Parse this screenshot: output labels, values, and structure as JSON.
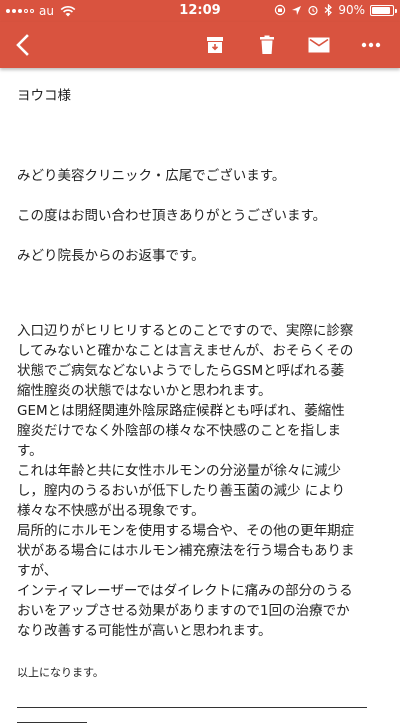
{
  "status_bar": {
    "carrier": "au",
    "time": "12:09",
    "battery_text": "90%",
    "battery_level": 0.9
  },
  "toolbar": {
    "icons": [
      "back-arrow-icon",
      "archive-icon",
      "trash-icon",
      "mail-icon",
      "more-icon"
    ],
    "color": "#d9533f"
  },
  "email": {
    "salutation": "ヨウコ様",
    "greeting": "みどり美容クリニック・広尾でございます。",
    "thanks": "この度はお問い合わせ頂きありがとうございます。",
    "intro": "みどり院長からのお返事です。",
    "body_lines": [
      "入口辺りがヒリヒリするとのことですので、実際に診察",
      "してみないと確かなことは言えませんが、おそらくその",
      "状態でご病気などないようでしたらGSMと呼ばれる萎",
      "縮性膣炎の状態ではないかと思われます。",
      "GEMとは閉経関連外陰尿路症候群とも呼ばれ、萎縮性",
      "膣炎だけでなく外陰部の様々な不快感のことを指しま",
      "す。",
      "これは年齢と共に女性ホルモンの分泌量が徐々に減少",
      "し，膣内のうるおいが低下したり善玉菌の減少 により",
      "様々な不快感が出る現象です。",
      "局所的にホルモンを使用する場合や、その他の更年期症",
      "状がある場合にはホルモン補充療法を行う場合もありま",
      "すが、",
      "インティマレーザーではダイレクトに痛みの部分のうる",
      "おいをアップさせる効果がありますので1回の治療でか",
      "なり改善する可能性が高いと思われます。"
    ],
    "closing": "以上になります。"
  }
}
